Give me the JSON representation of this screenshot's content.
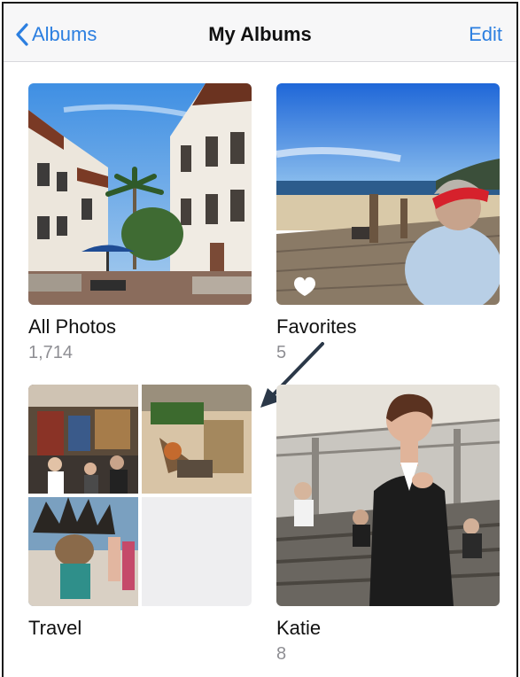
{
  "nav": {
    "back_label": "Albums",
    "title": "My Albums",
    "edit_label": "Edit"
  },
  "albums": [
    {
      "name": "All Photos",
      "count": "1,714"
    },
    {
      "name": "Favorites",
      "count": "5"
    },
    {
      "name": "Travel",
      "count": ""
    },
    {
      "name": "Katie",
      "count": "8"
    }
  ],
  "colors": {
    "accent": "#2c7fe0",
    "secondary_text": "#8e8e93",
    "nav_background": "#f7f7f8"
  },
  "icons": {
    "back": "chevron-left-icon",
    "favorite": "heart-icon"
  }
}
